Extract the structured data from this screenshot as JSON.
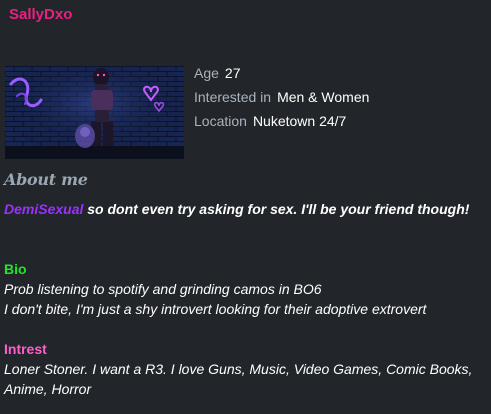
{
  "profile": {
    "username": "SallyDxo",
    "age_label": "Age",
    "age_value": "27",
    "interested_label": "Interested in",
    "interested_value": "Men & Women",
    "location_label": "Location",
    "location_value": "Nuketown 24/7"
  },
  "about": {
    "heading": "About me",
    "demi_tag": "DemiSexual",
    "demi_rest": " so dont even try asking for sex. I'll be your friend though!",
    "bio_label": "Bio",
    "bio_line1": "Prob listening to spotify and grinding camos in BO6",
    "bio_line2": "I don't bite, I'm just a shy introvert looking for their adoptive extrovert",
    "interest_label": "Intrest",
    "interest_text": "Loner Stoner. I want a R3. I love Guns, Music, Video Games, Comic Books, Anime, Horror"
  },
  "colors": {
    "background": "#22262a",
    "username": "#e8207f",
    "demi_tag": "#9b30ff",
    "bio_label": "#22e52a",
    "interest_label": "#ff5ecd",
    "field_label": "#a9b3bd",
    "heading": "#9aa6b2"
  }
}
